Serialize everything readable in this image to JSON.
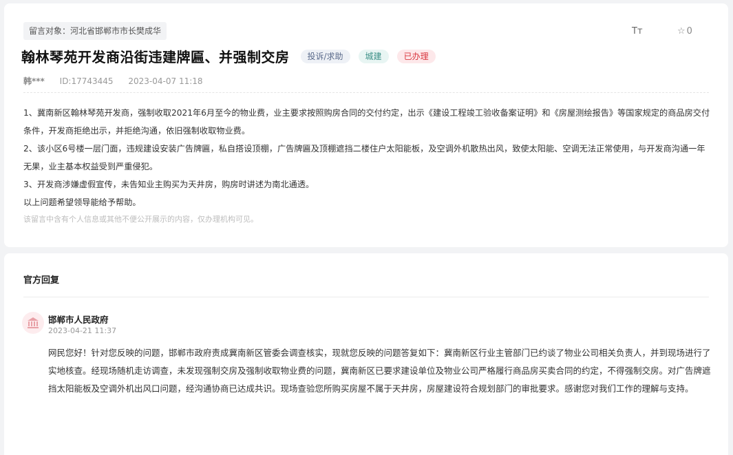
{
  "message": {
    "target_label": "留言对象：河北省邯郸市市长樊成华",
    "font_toggle": "Tт",
    "favorite_count": "0",
    "title": "翰林琴苑开发商沿街违建牌匾、并强制交房",
    "tags": {
      "type": "投诉/求助",
      "field": "城建",
      "status": "已办理"
    },
    "author": "韩***",
    "id": "ID:17743445",
    "datetime": "2023-04-07 11:18",
    "paragraphs": [
      "1、冀南新区翰林琴苑开发商，强制收取2021年6月至今的物业费，业主要求按照购房合同的交付约定，出示《建设工程竣工验收备案证明》和《房屋测绘报告》等国家规定的商品房交付条件，开发商拒绝出示，并拒绝沟通，依旧强制收取物业费。",
      "2、该小区6号楼一层门面，违规建设安装广告牌匾，私自搭设顶棚，广告牌匾及顶棚遮挡二楼住户太阳能板，及空调外机散热出风，致使太阳能、空调无法正常使用，与开发商沟通一年无果，业主基本权益受到严重侵犯。",
      "3、开发商涉嫌虚假宣传，未告知业主购买为天井房，购房时讲述为南北通透。",
      "以上问题希望领导能给予帮助。"
    ],
    "privacy_note": "该留言中含有个人信息或其他不便公开展示的内容，仅办理机构可见。"
  },
  "reply": {
    "section_title": "官方回复",
    "org_name": "邯郸市人民政府",
    "datetime": "2023-04-21 11:37",
    "body": "网民您好！针对您反映的问题，邯郸市政府责成冀南新区管委会调查核实，现就您反映的问题答复如下：冀南新区行业主管部门已约谈了物业公司相关负责人，并到现场进行了实地核查。经现场随机走访调查，未发现强制交房及强制收取物业费的问题，冀南新区已要求建设单位及物业公司严格履行商品房买卖合同的约定，不得强制交房。对广告牌遮挡太阳能板及空调外机出风口问题，经沟通协商已达成共识。现场查验您所购买房屋不属于天井房，房屋建设符合规划部门的审批要求。感谢您对我们工作的理解与支持。"
  },
  "colors": {
    "status_red": "#d9363e",
    "avatar_bg": "#fdecee",
    "avatar_icon": "#e8a0a6"
  },
  "icons": {
    "font_size": "font-size-icon",
    "favorite": "star-icon",
    "org": "government-building-icon"
  }
}
